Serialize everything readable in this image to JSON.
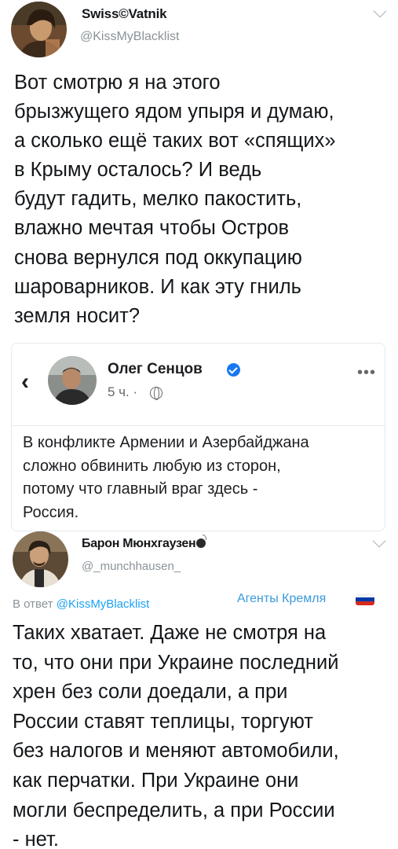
{
  "colors": {
    "text": "#14171a",
    "secondary_text": "#8a9399",
    "link": "#1da1f2",
    "facebook_verified": "#1877f2"
  },
  "tweet1": {
    "display_name": "Swiss©Vatnik",
    "handle": "@KissMyBlacklist",
    "menu_icon": "chevron-down-icon",
    "text_lines": [
      "Вот смотрю я на этого",
      "брызжущего ядом упыря и думаю,",
      "а сколько ещё таких вот «спящих»",
      "в Крыму осталось? И ведь",
      "будут гадить, мелко пакостить,",
      "влажно мечтая чтобы Остров",
      "снова вернулся под оккупацию",
      "шароварников. И как эту гниль",
      "земля носит?"
    ],
    "embedded_post": {
      "back_icon": "‹",
      "author": "Олег Сенцов",
      "verified_icon": "verified-badge-icon",
      "time": "5 ч. ·",
      "audience_icon": "globe-icon",
      "more_icon": "•••",
      "text_lines": [
        "В конфликте Армении и Азербайджана",
        "сложно обвинить любую из сторон,",
        "потому что главный враг здесь -",
        "Россия."
      ]
    }
  },
  "tweet2": {
    "display_name": "Барон Мюнхгаузен",
    "name_emoji": "bomb-icon",
    "handle": "@_munchhausen_",
    "menu_icon": "chevron-down-icon",
    "reply_prefix": "В ответ",
    "reply_handle": "@KissMyBlacklist",
    "overlay_label": "Агенты Кремля",
    "flag_colors": [
      "#ffffff",
      "#0039a6",
      "#d52b1e"
    ],
    "text_lines": [
      "Таких хватает. Даже не смотря на",
      "то, что они при Украине последний",
      "хрен без соли доедали, а при",
      "России ставят теплицы, торгуют",
      "без налогов и меняют автомобили,",
      "как перчатки. При Украине они",
      "могли беспределить, а при России",
      "- нет."
    ]
  }
}
